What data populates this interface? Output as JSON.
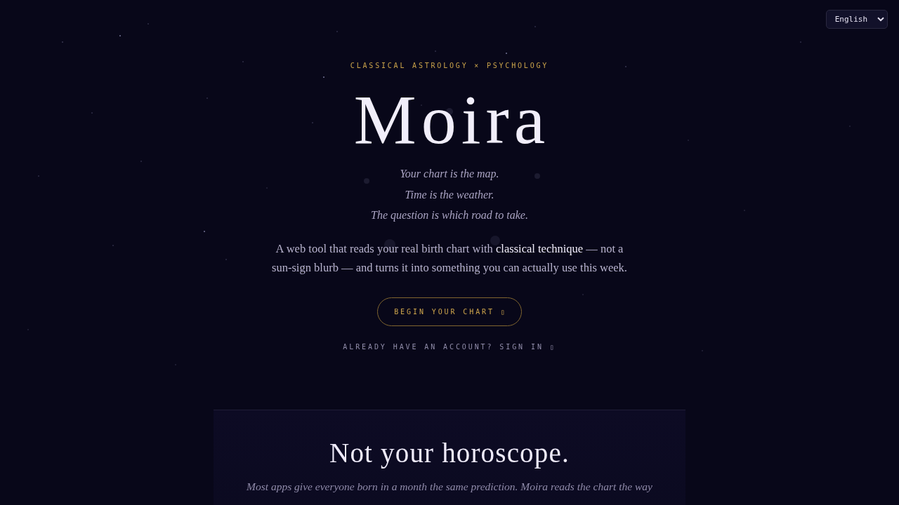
{
  "language_select": {
    "value": "English"
  },
  "hero": {
    "eyebrow": "CLASSICAL ASTROLOGY × PSYCHOLOGY",
    "title": "Moira",
    "tagline": [
      "Your chart is the map.",
      "Time is the weather.",
      "The question is which road to take."
    ],
    "description": "A web tool that reads your real birth chart with **classical technique** — not a sun-sign blurb — and turns it into something you can actually use this week.",
    "primary_button": "BEGIN YOUR CHART ▯",
    "sign_in_link": "ALREADY HAVE AN ACCOUNT? SIGN IN ▯"
  },
  "section": {
    "heading": "Not your horoscope.",
    "body": "Most apps give everyone born in a month the same prediction. Moira reads the chart the way"
  }
}
